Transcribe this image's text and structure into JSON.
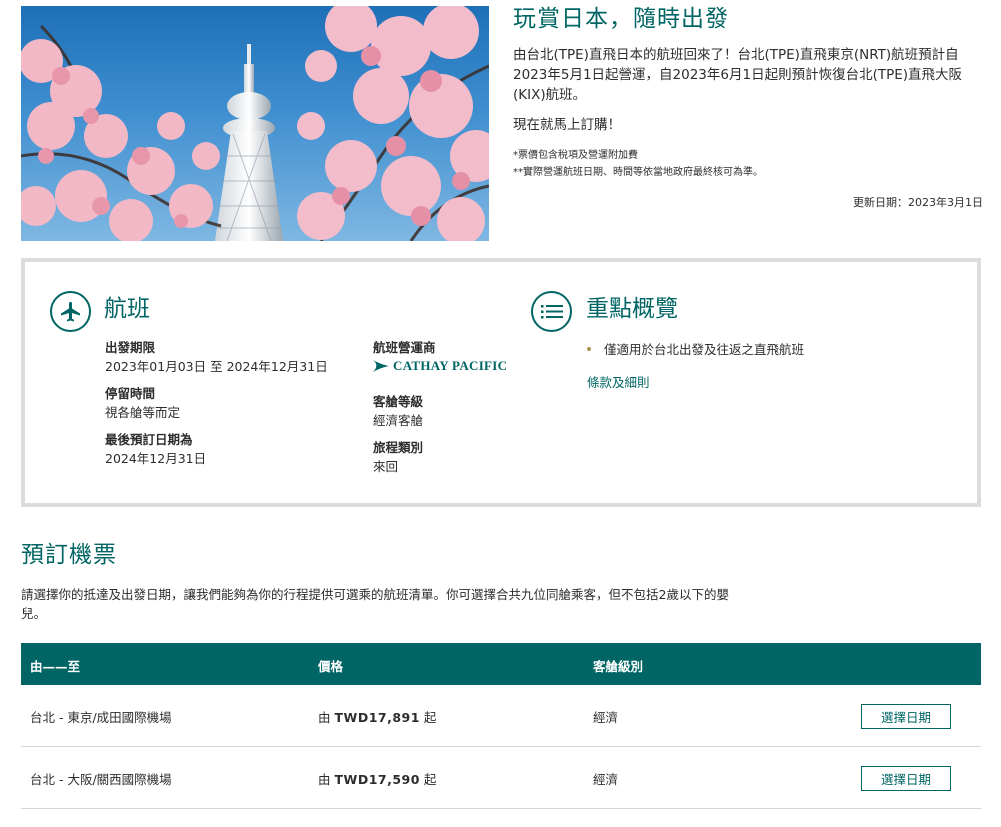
{
  "hero": {
    "image_alt": "Tokyo Skytree with cherry blossoms",
    "title": "玩賞日本，隨時出發",
    "body": "由台北(TPE)直飛日本的航班回來了！台北(TPE)直飛東京(NRT)航班預計自2023年5月1日起營運，自2023年6月1日起則預計恢復台北(TPE)直飛大阪(KIX)航班。",
    "cta": "現在就馬上訂購！",
    "notes": [
      "*票價包含稅項及營運附加費",
      "**實際營運航班日期、時間等依當地政府最終核可為準。"
    ],
    "updated": "更新日期：2023年3月1日"
  },
  "info": {
    "flight_heading": "航班",
    "fields_left": [
      {
        "label": "出發期限",
        "value": "2023年01月03日  至 2024年12月31日"
      },
      {
        "label": "停留時間",
        "value": "視各艙等而定"
      },
      {
        "label": "最後預訂日期為",
        "value": "2024年12月31日"
      }
    ],
    "operator_label": "航班營運商",
    "operator_logo_text": "CATHAY PACIFIC",
    "fields_right": [
      {
        "label": "客艙等級",
        "value": "經濟客艙"
      },
      {
        "label": "旅程類別",
        "value": "來回"
      }
    ],
    "highlights_heading": "重點概覽",
    "highlights": [
      "僅適用於台北出發及往返之直飛航班"
    ],
    "terms_link": "條款及細則"
  },
  "booking": {
    "title": "預訂機票",
    "description": "請選擇你的抵達及出發日期，讓我們能夠為你的行程提供可選乘的航班清單。你可選擇合共九位同艙乘客，但不包括2歲以下的嬰兒。",
    "headers": {
      "route": "由——至",
      "price": "價格",
      "cabin": "客艙級別"
    },
    "rows": [
      {
        "route": "台北 - 東京/成田國際機場",
        "price_prefix": "由",
        "price": "TWD17,891",
        "price_suffix": "起",
        "cabin": "經濟",
        "button": "選擇日期"
      },
      {
        "route": "台北 - 大阪/關西國際機場",
        "price_prefix": "由",
        "price": "TWD17,590",
        "price_suffix": "起",
        "cabin": "經濟",
        "button": "選擇日期"
      }
    ]
  },
  "colors": {
    "brand": "#006564",
    "accent_gold": "#a89257",
    "panel_border": "#dcdcdc"
  }
}
